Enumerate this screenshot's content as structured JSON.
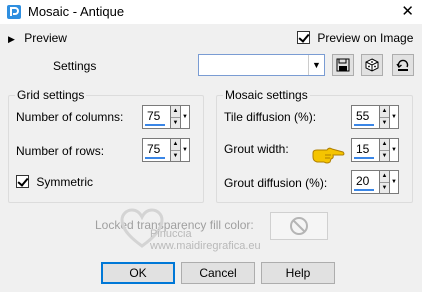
{
  "window": {
    "title": "Mosaic - Antique",
    "close_glyph": "✕"
  },
  "preview": {
    "label": "Preview",
    "arrow_icon": "triangle-right-icon"
  },
  "preview_on_image": {
    "label": "Preview on Image",
    "checked": true
  },
  "settings": {
    "label": "Settings",
    "selected": ""
  },
  "grid_settings": {
    "title": "Grid settings",
    "columns": {
      "label": "Number of columns:",
      "value": "75"
    },
    "rows": {
      "label": "Number of rows:",
      "value": "75"
    },
    "symmetric": {
      "label": "Symmetric",
      "checked": true
    }
  },
  "mosaic_settings": {
    "title": "Mosaic settings",
    "tile_diffusion": {
      "label": "Tile diffusion (%):",
      "value": "55"
    },
    "grout_width": {
      "label": "Grout width:",
      "value": "15"
    },
    "grout_diffusion": {
      "label": "Grout diffusion (%):",
      "value": "20"
    }
  },
  "locked_transparency": {
    "label": "Locked transparency fill color:"
  },
  "watermark": {
    "line1": "Pinuccia",
    "line2": "www.maidiregrafica.eu"
  },
  "buttons": {
    "ok": "OK",
    "cancel": "Cancel",
    "help": "Help"
  },
  "colors": {
    "accent": "#3a86e6",
    "dialog_bg": "#f0f0f0",
    "default_border": "#0078d7"
  }
}
